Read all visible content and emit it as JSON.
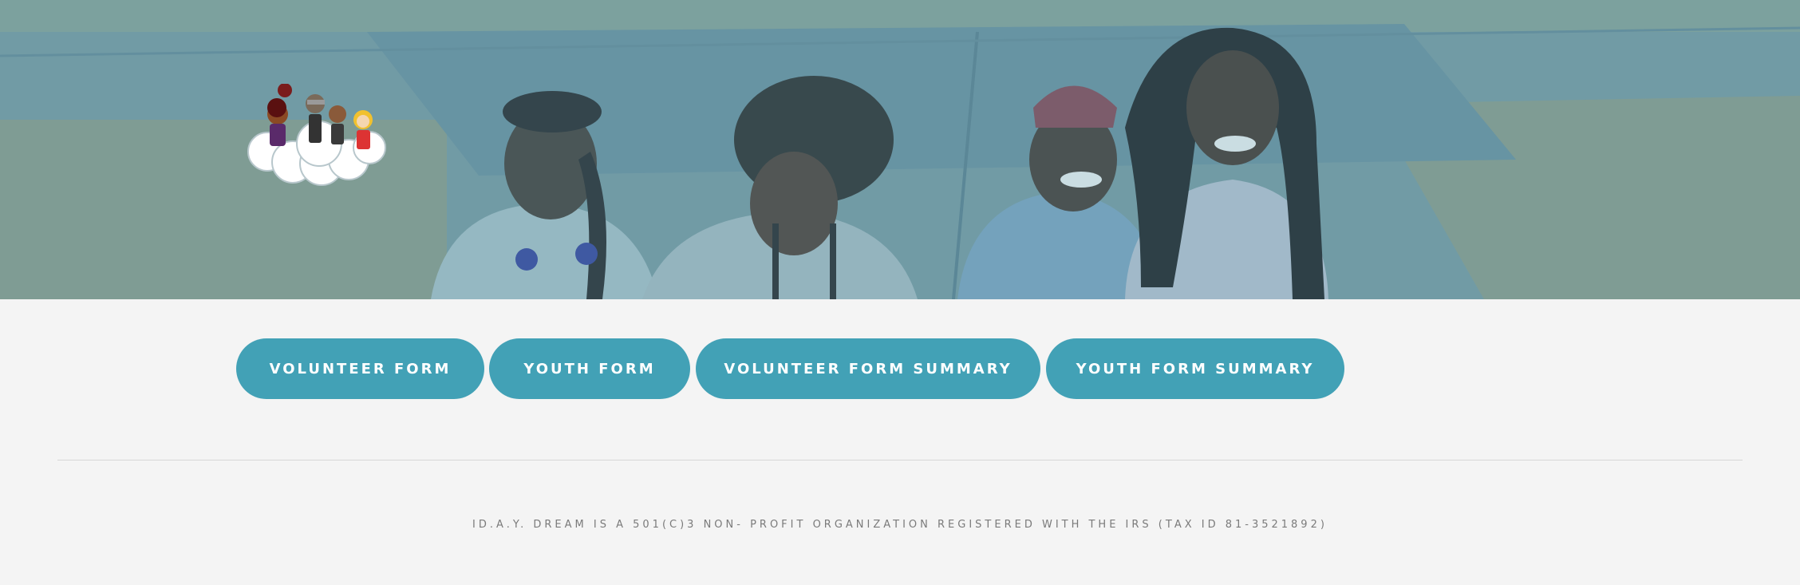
{
  "hero": {
    "image": "four-smiling-girls-sitting-outdoors",
    "overlay_color": "#4f93a8"
  },
  "logo": {
    "icon": "cartoon-kids-on-cloud-icon"
  },
  "nav": {
    "buttons": [
      {
        "label": "VOLUNTEER FORM"
      },
      {
        "label": "YOUTH FORM"
      },
      {
        "label": "VOLUNTEER FORM SUMMARY"
      },
      {
        "label": "YOUTH FORM SUMMARY"
      }
    ],
    "button_color": "#42a1b6"
  },
  "footer": {
    "text": "ID.A.Y. DREAM IS A 501(C)3 NON- PROFIT ORGANIZATION REGISTERED WITH THE IRS (TAX ID 81-3521892)"
  }
}
